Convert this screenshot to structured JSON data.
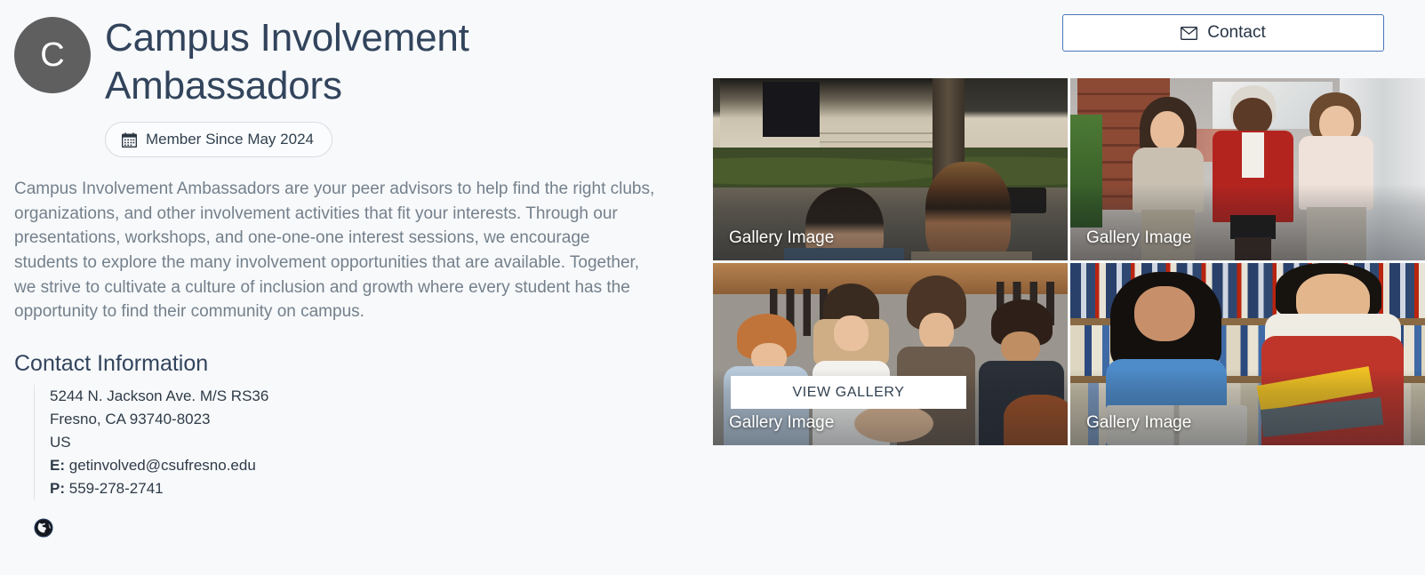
{
  "organization": {
    "avatar_initial": "C",
    "name": "Campus Involvement Ambassadors",
    "member_badge": "Member Since May 2024",
    "calendar_icon": "calendar-icon",
    "description": "Campus Involvement Ambassadors are your peer advisors to help find the right clubs, organizations, and other involvement activities that fit your interests. Through our presentations, workshops, and one-one-one interest sessions, we encourage students to explore the many involvement opportunities that are available. Together, we strive to cultivate a culture of inclusion and growth where every student has the opportunity to find their community on campus."
  },
  "contact_info": {
    "heading": "Contact Information",
    "address_line1": "5244 N. Jackson Ave. M/S RS36",
    "address_line2": "Fresno, CA 93740-8023",
    "country": "US",
    "email_label": "E:",
    "email": "getinvolved@csufresno.edu",
    "phone_label": "P:",
    "phone": "559-278-2741"
  },
  "social": {
    "website_icon": "globe-icon"
  },
  "contact_button": {
    "label": "Contact",
    "icon": "envelope-icon",
    "border_color": "#4a76b8"
  },
  "gallery": {
    "view_gallery_label": "VIEW GALLERY",
    "tiles": [
      {
        "caption": "Gallery Image",
        "alt": "two students smiling outdoors on campus"
      },
      {
        "caption": "Gallery Image",
        "alt": "three women walking together indoors"
      },
      {
        "caption": "Gallery Image",
        "alt": "group of students with hands together over a table"
      },
      {
        "caption": "Gallery Image",
        "alt": "two students reading books in a library"
      }
    ]
  },
  "colors": {
    "page_background": "#f7f9fb",
    "title": "#32445c",
    "body_text": "#74808b",
    "avatar_background": "#5f5f5f",
    "accent_blue": "#4a76b8"
  }
}
